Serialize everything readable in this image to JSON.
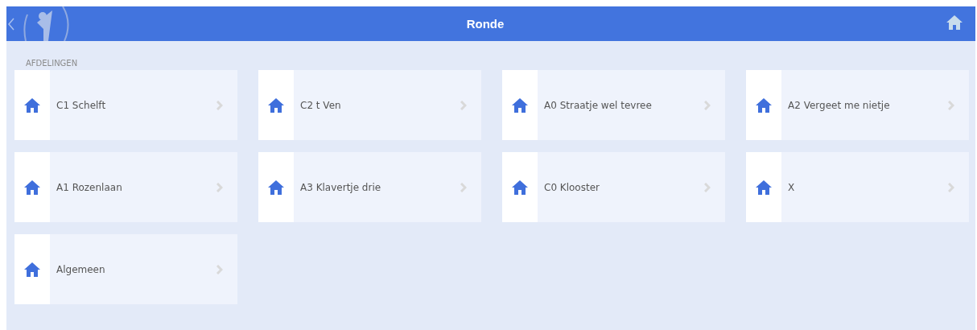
{
  "header": {
    "title": "Ronde"
  },
  "section": {
    "label": "AFDELINGEN"
  },
  "departments": [
    {
      "name": "C1 Schelft"
    },
    {
      "name": "C2 t Ven"
    },
    {
      "name": "A0 Straatje wel tevree"
    },
    {
      "name": "A2 Vergeet me nietje"
    },
    {
      "name": "A1 Rozenlaan"
    },
    {
      "name": "A3 Klavertje drie"
    },
    {
      "name": "C0 Klooster"
    },
    {
      "name": "X"
    },
    {
      "name": "Algemeen"
    }
  ]
}
